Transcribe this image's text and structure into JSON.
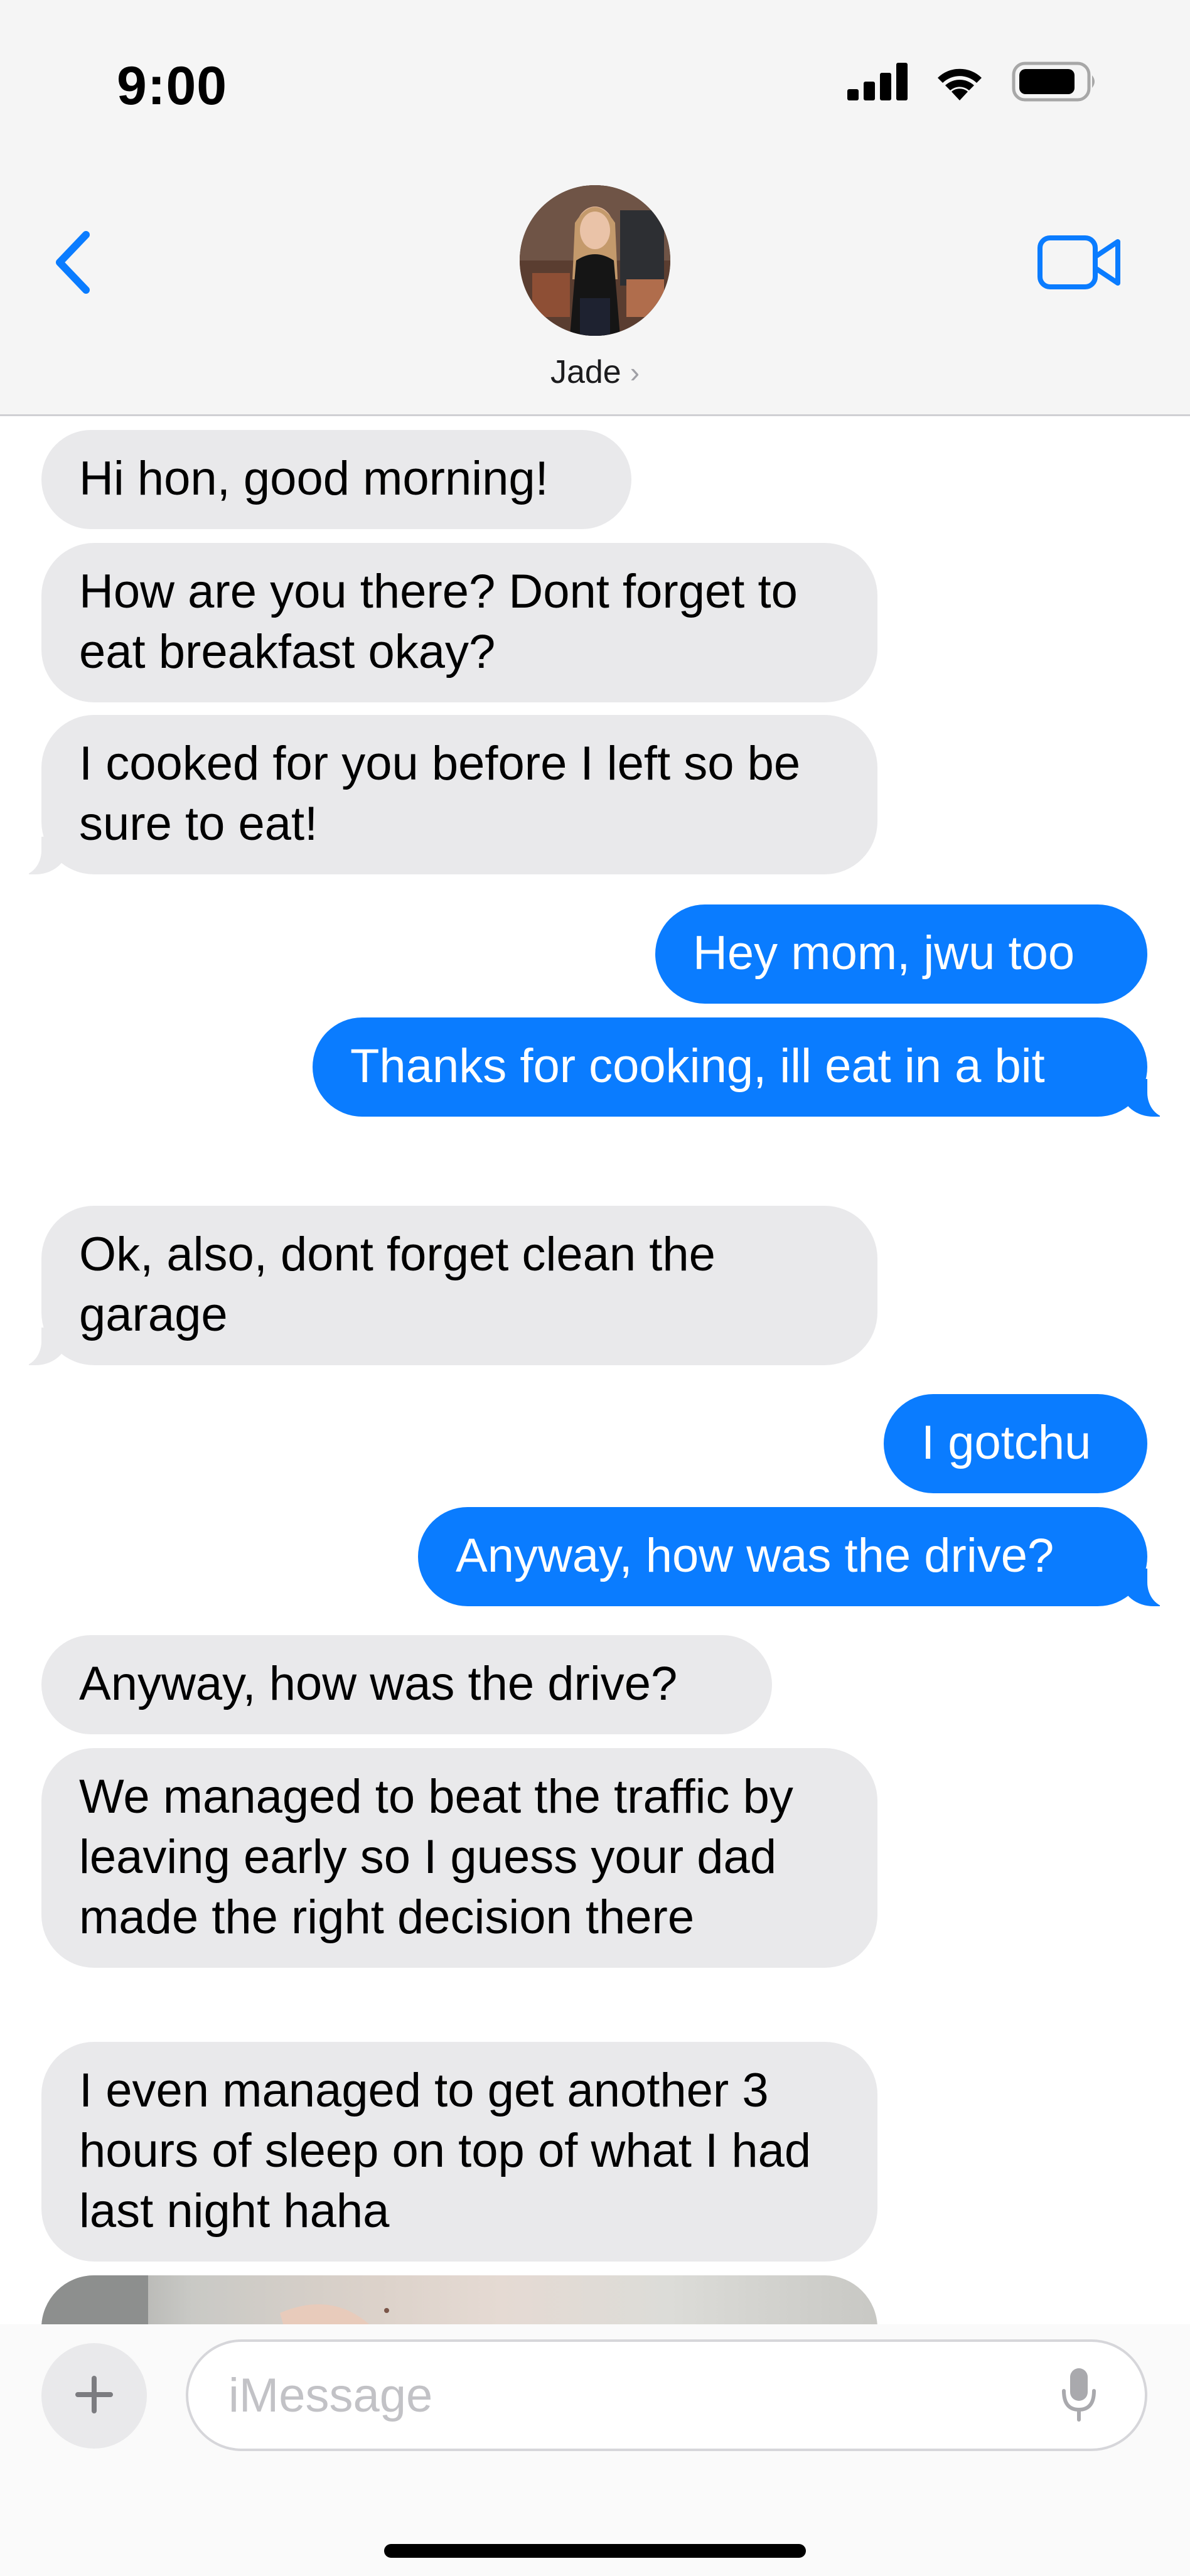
{
  "status_bar": {
    "time": "9:00",
    "signal_icon": "cellular-signal-icon",
    "wifi_icon": "wifi-icon",
    "battery_icon": "battery-icon"
  },
  "header": {
    "back_icon": "chevron-left-icon",
    "video_icon": "video-camera-icon",
    "contact_name": "Jade",
    "contact_chevron": "›"
  },
  "messages": [
    {
      "from": "them",
      "text": "Hi hon, good morning!"
    },
    {
      "from": "them",
      "text": "How are you there? Dont forget to eat breakfast okay?"
    },
    {
      "from": "them",
      "text": "I cooked for you before I left so be sure to eat!"
    },
    {
      "from": "me",
      "text": "Hey mom, jwu too"
    },
    {
      "from": "me",
      "text": "Thanks for cooking, ill eat in a bit"
    },
    {
      "from": "them",
      "text": "Ok, also, dont forget clean the garage"
    },
    {
      "from": "me",
      "text": "I gotchu"
    },
    {
      "from": "me",
      "text": "Anyway, how was the drive?"
    },
    {
      "from": "them",
      "text": "Anyway, how was the drive?"
    },
    {
      "from": "them",
      "text": "We managed to beat the traffic by leaving early so I guess your dad made the right decision there"
    },
    {
      "from": "them",
      "text": "I even managed to get another 3 hours of sleep on top of what I had last night haha"
    }
  ],
  "composer": {
    "plus_icon": "plus-icon",
    "placeholder": "iMessage",
    "value": "",
    "mic_icon": "microphone-icon"
  },
  "colors": {
    "accent_blue": "#0a7cff",
    "incoming_bubble": "#e9e9eb",
    "header_bg": "#f5f5f5"
  }
}
